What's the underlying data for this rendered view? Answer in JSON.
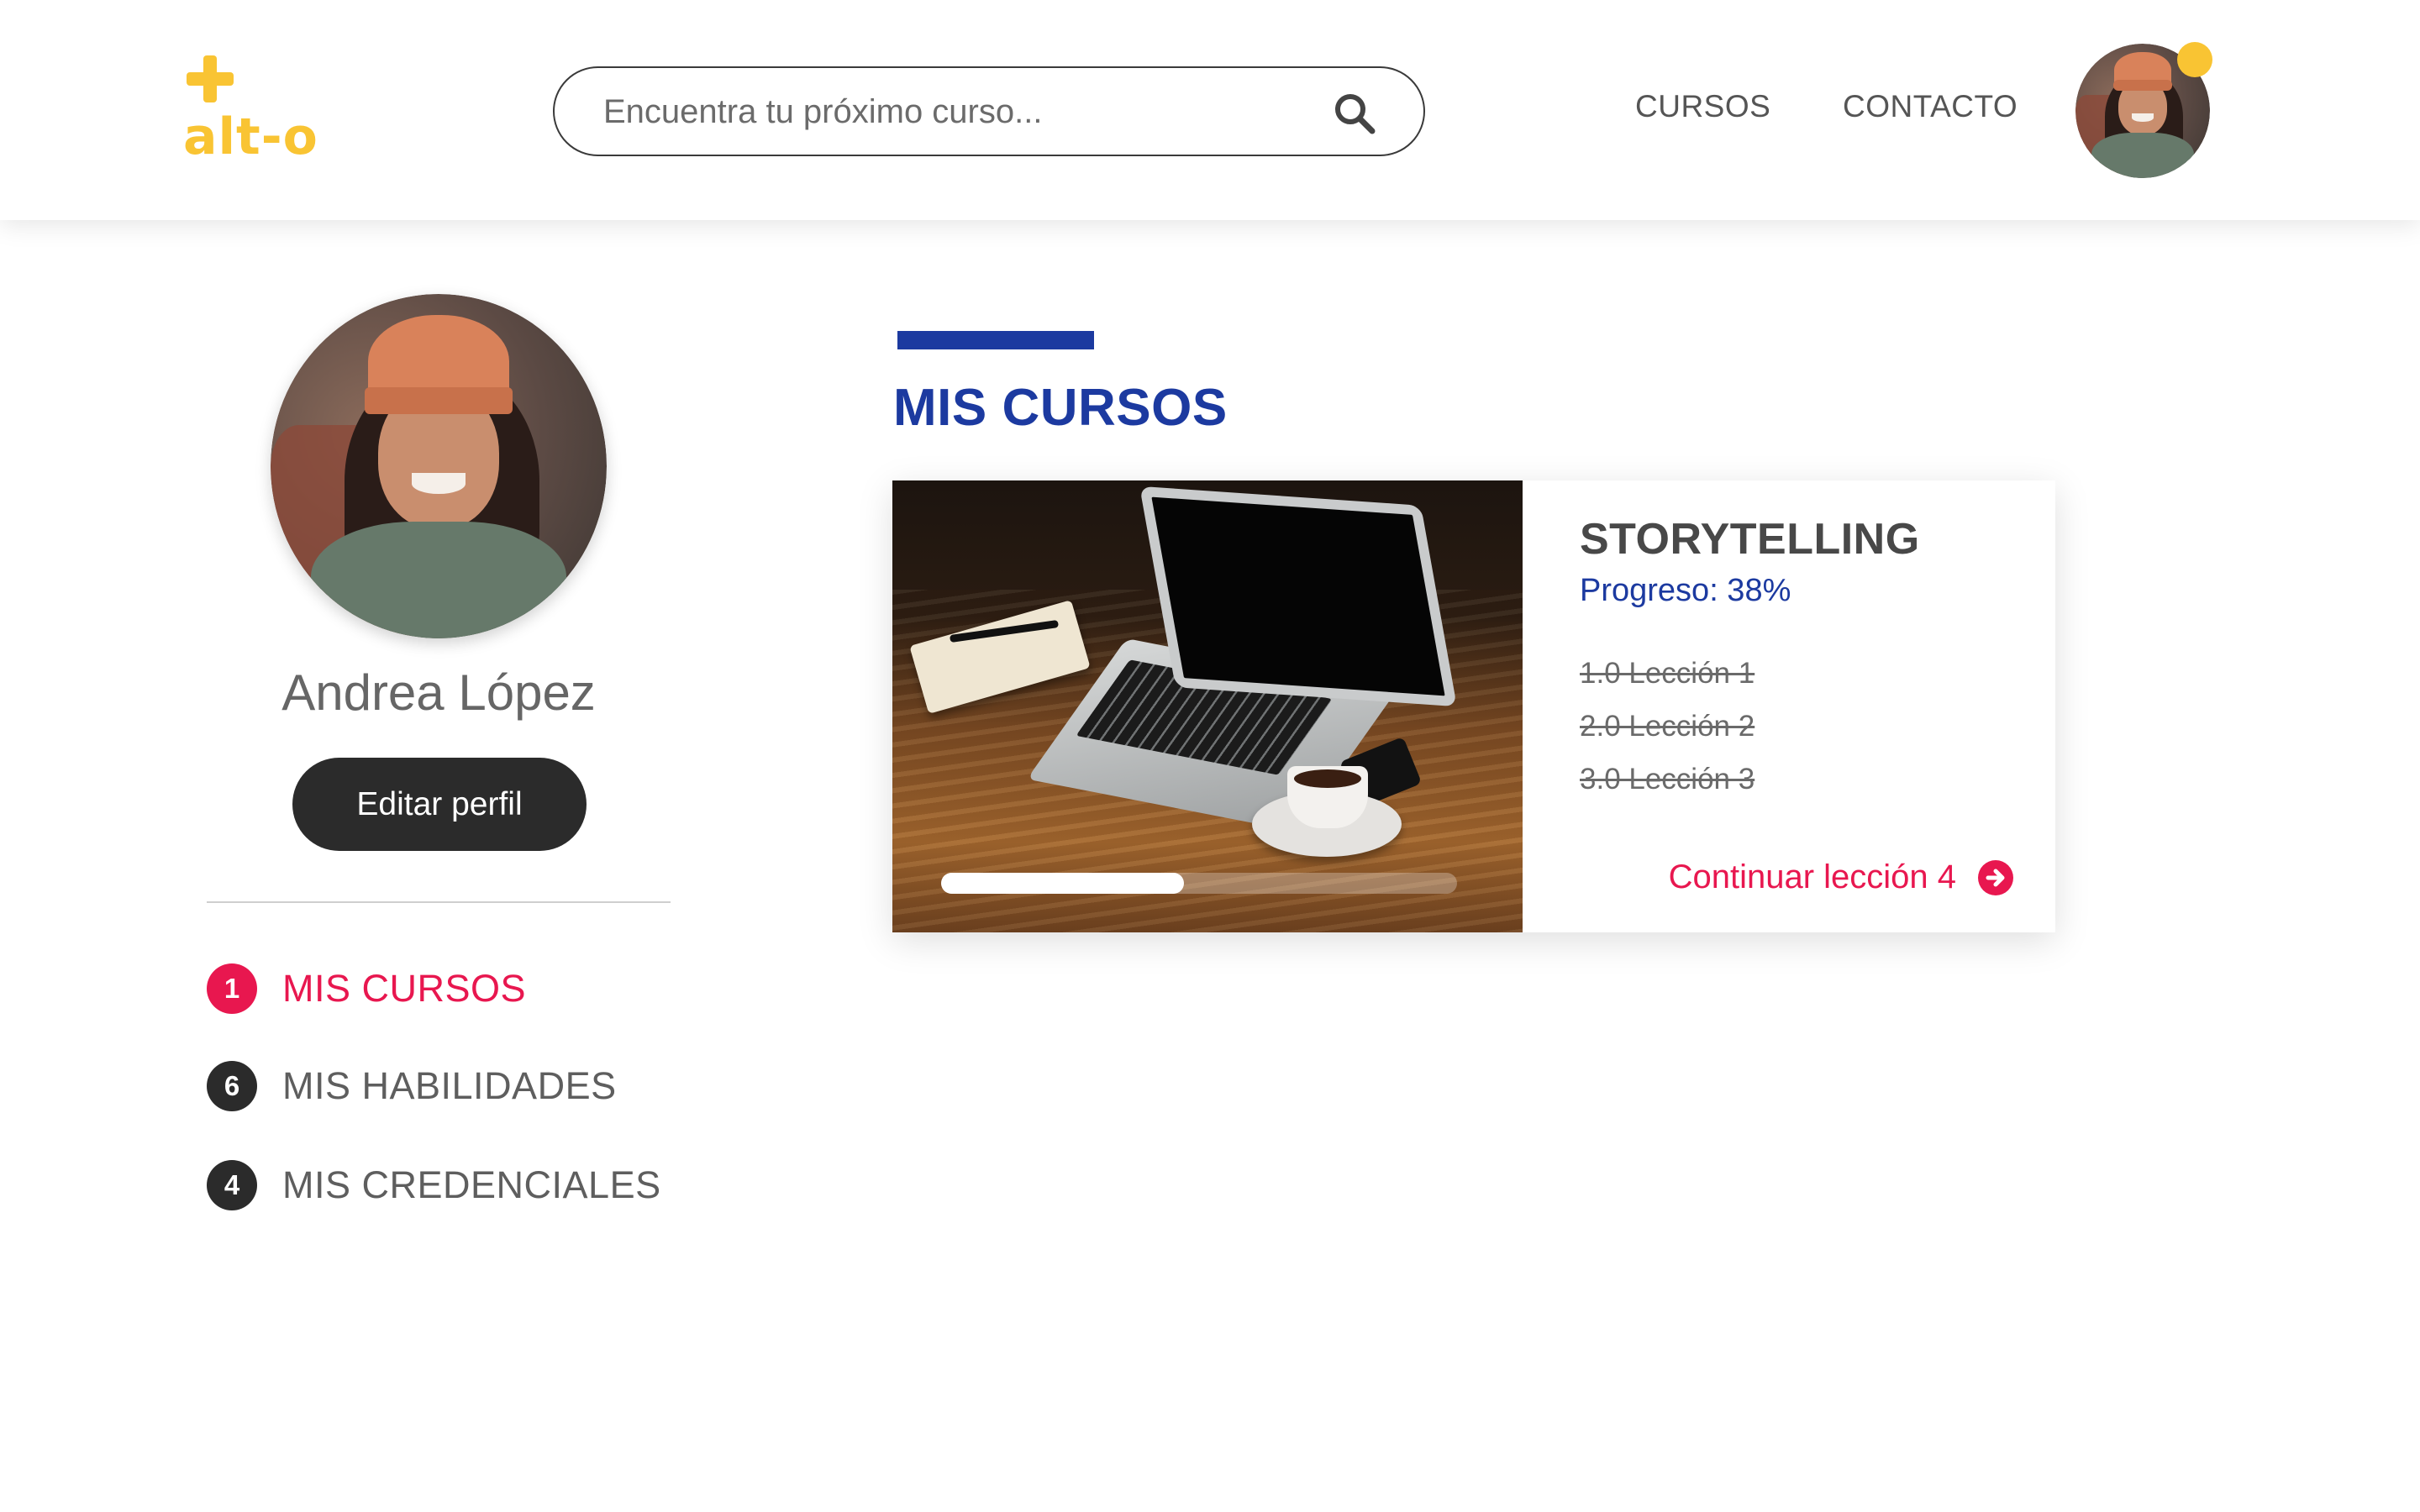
{
  "header": {
    "logo_text": "alt-o",
    "search": {
      "placeholder": "Encuentra tu próximo curso..."
    },
    "nav": [
      {
        "label": "CURSOS"
      },
      {
        "label": "CONTACTO"
      }
    ],
    "avatar_icon": "user-avatar",
    "notification_color": "#f9c433"
  },
  "sidebar": {
    "user_name": "Andrea López",
    "edit_profile_label": "Editar perfil",
    "menu": [
      {
        "badge": "1",
        "label": "MIS CURSOS",
        "active": true
      },
      {
        "badge": "6",
        "label": "MIS HABILIDADES",
        "active": false
      },
      {
        "badge": "4",
        "label": "MIS CREDENCIALES",
        "active": false
      }
    ]
  },
  "main": {
    "section_title": "MIS CURSOS",
    "courses": [
      {
        "title": "STORYTELLING",
        "progress_text": "Progreso: 38%",
        "progress_value": 0.47,
        "lessons": [
          "1.0 Lección 1",
          "2.0 Lección 2",
          "3.0 Lección 3"
        ],
        "continue_label": "Continuar lección 4",
        "continue_icon": "arrow-circle-right-icon"
      }
    ]
  },
  "colors": {
    "brand_yellow": "#f9c433",
    "primary_blue": "#1c3aa0",
    "accent_pink": "#e8174f",
    "dark": "#2b2b2b"
  }
}
